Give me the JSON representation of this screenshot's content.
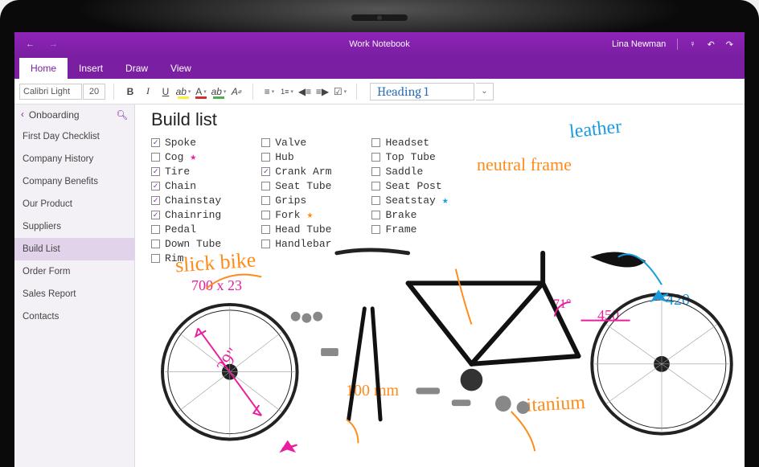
{
  "titlebar": {
    "notebook_name": "Work Notebook",
    "user_name": "Lina Newman"
  },
  "ribbon": {
    "tabs": [
      "Home",
      "Insert",
      "Draw",
      "View"
    ],
    "active": "Home"
  },
  "toolbar": {
    "font_name": "Calibri Light",
    "font_size": "20",
    "style_label": "Heading 1"
  },
  "sidebar": {
    "section": "Onboarding",
    "items": [
      "First Day Checklist",
      "Company History",
      "Company Benefits",
      "Our Product",
      "Suppliers",
      "Build List",
      "Order Form",
      "Sales Report",
      "Contacts"
    ],
    "active": "Build List"
  },
  "page": {
    "title": "Build list",
    "checklist": {
      "col1": [
        {
          "label": "Spoke",
          "checked": true
        },
        {
          "label": "Cog",
          "checked": false,
          "star": "pink"
        },
        {
          "label": "Tire",
          "checked": true
        },
        {
          "label": "Chain",
          "checked": true
        },
        {
          "label": "Chainstay",
          "checked": true
        },
        {
          "label": "Chainring",
          "checked": true
        },
        {
          "label": "Pedal",
          "checked": false
        },
        {
          "label": "Down Tube",
          "checked": false
        },
        {
          "label": "Rim",
          "checked": false
        }
      ],
      "col2": [
        {
          "label": "Valve",
          "checked": false
        },
        {
          "label": "Hub",
          "checked": false
        },
        {
          "label": "Crank Arm",
          "checked": true
        },
        {
          "label": "Seat Tube",
          "checked": false
        },
        {
          "label": "Grips",
          "checked": false
        },
        {
          "label": "Fork",
          "checked": false,
          "star": "orange"
        },
        {
          "label": "Head Tube",
          "checked": false
        },
        {
          "label": "Handlebar",
          "checked": false
        }
      ],
      "col3": [
        {
          "label": "Headset",
          "checked": false
        },
        {
          "label": "Top Tube",
          "checked": false
        },
        {
          "label": "Saddle",
          "checked": false
        },
        {
          "label": "Seat Post",
          "checked": false
        },
        {
          "label": "Seatstay",
          "checked": false,
          "star": "blue"
        },
        {
          "label": "Brake",
          "checked": false
        },
        {
          "label": "Frame",
          "checked": false
        }
      ]
    },
    "annotations": {
      "slick_bike": "slick bike",
      "tire_size": "700 x 23",
      "wheel_in": "29\"",
      "fork_mm": "100 mm",
      "titanium": "titanium",
      "neutral_frame": "neutral frame",
      "leather": "leather",
      "angle": "71°",
      "len450": "450",
      "len420": "420"
    }
  }
}
